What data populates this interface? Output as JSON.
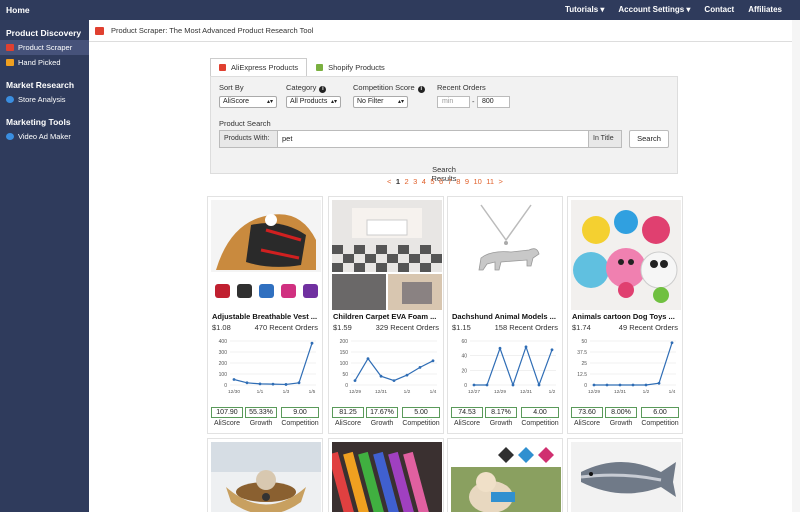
{
  "topbar": {
    "home": "Home",
    "nav": [
      "Tutorials ▾",
      "Account Settings ▾",
      "Contact",
      "Affiliates"
    ]
  },
  "sidebar": {
    "sections": [
      {
        "heading": "Product Discovery",
        "items": [
          {
            "label": "Product Scraper",
            "icon": "scraper-icon",
            "color": "#e04030",
            "active": true
          },
          {
            "label": "Hand Picked",
            "icon": "gift-icon",
            "color": "#f0a020",
            "active": false
          }
        ]
      },
      {
        "heading": "Market Research",
        "items": [
          {
            "label": "Store Analysis",
            "icon": "globe-icon",
            "color": "#3a8ee0",
            "active": false
          }
        ]
      },
      {
        "heading": "Marketing Tools",
        "items": [
          {
            "label": "Video Ad Maker",
            "icon": "video-icon",
            "color": "#3a8ee0",
            "active": false
          }
        ]
      }
    ]
  },
  "main": {
    "title": "Product Scraper:  The Most Advanced Product Research Tool",
    "tabs": [
      {
        "label": "AliExpress Products",
        "color": "#e04030"
      },
      {
        "label": "Shopify Products",
        "color": "#7ab040"
      }
    ],
    "filters": {
      "sort_by": {
        "label": "Sort By",
        "value": "AliScore"
      },
      "category": {
        "label": "Category",
        "value": "All Products"
      },
      "competition": {
        "label": "Competition Score",
        "value": "No Filter"
      },
      "recent_orders": {
        "label": "Recent Orders",
        "min_placeholder": "min",
        "dash": "-",
        "max_value": "800"
      },
      "product_search": {
        "label": "Product Search",
        "prefix": "Products With:",
        "query": "pet",
        "suffix": "In Title",
        "button": "Search"
      }
    },
    "results_title": "Search Results",
    "pagination": [
      "<",
      "1",
      "2",
      "3",
      "4",
      "5",
      "6",
      "7",
      "8",
      "9",
      "10",
      "11",
      ">"
    ],
    "current_page": "1",
    "metric_labels": [
      "AliScore",
      "Growth",
      "Competition"
    ],
    "products": [
      {
        "name": "Adjustable Breathable Vest ...",
        "price": "$1.08",
        "orders": "470 Recent Orders",
        "aliscore": "107.90",
        "growth": "55.33%",
        "competition": "9.00",
        "chart": {
          "yticks": [
            "400",
            "300",
            "200",
            "100",
            "0"
          ],
          "xticks": [
            "12/30",
            "1/1",
            "1/3",
            "1/5"
          ],
          "ylim": [
            0,
            400
          ],
          "values": [
            50,
            20,
            10,
            8,
            5,
            20,
            380
          ]
        }
      },
      {
        "name": "Children Carpet EVA Foam ...",
        "price": "$1.59",
        "orders": "329 Recent Orders",
        "aliscore": "81.25",
        "growth": "17.67%",
        "competition": "5.00",
        "chart": {
          "yticks": [
            "200",
            "150",
            "100",
            "50",
            "0"
          ],
          "xticks": [
            "12/29",
            "12/31",
            "1/2",
            "1/4"
          ],
          "ylim": [
            0,
            200
          ],
          "values": [
            20,
            120,
            40,
            20,
            45,
            80,
            110
          ]
        }
      },
      {
        "name": "Dachshund Animal Models ...",
        "price": "$1.15",
        "orders": "158 Recent Orders",
        "aliscore": "74.53",
        "growth": "8.17%",
        "competition": "4.00",
        "chart": {
          "yticks": [
            "60",
            "40",
            "20",
            "0"
          ],
          "xticks": [
            "12/27",
            "12/29",
            "12/31",
            "1/2"
          ],
          "ylim": [
            0,
            60
          ],
          "values": [
            0,
            0,
            50,
            0,
            52,
            0,
            48
          ]
        }
      },
      {
        "name": "Animals cartoon Dog Toys ...",
        "price": "$1.74",
        "orders": "49 Recent Orders",
        "aliscore": "73.60",
        "growth": "8.00%",
        "competition": "6.00",
        "chart": {
          "yticks": [
            "50",
            "37.5",
            "25",
            "12.5",
            "0"
          ],
          "xticks": [
            "12/29",
            "12/31",
            "1/2",
            "1/4"
          ],
          "ylim": [
            0,
            50
          ],
          "values": [
            0,
            0,
            0,
            0,
            0,
            2,
            48
          ]
        }
      }
    ]
  }
}
